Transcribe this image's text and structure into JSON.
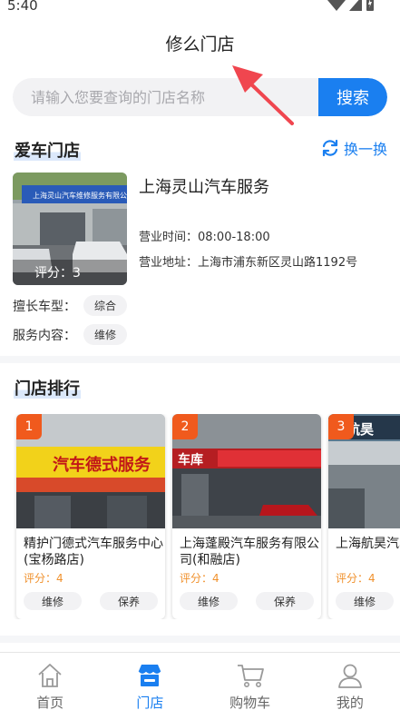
{
  "status_bar": {
    "time": "5:40"
  },
  "header": {
    "title": "修么门店"
  },
  "search": {
    "placeholder": "请输入您要查询的门店名称",
    "button_label": "搜索"
  },
  "favorite": {
    "section_title": "爱车门店",
    "swap_label": "换一换",
    "store": {
      "name": "上海灵山汽车服务",
      "rating": "评分：3",
      "hours": "营业时间：08:00-18:00",
      "address": "营业地址：上海市浦东新区灵山路1192号"
    },
    "photo_sign_text": "上海灵山汽车维修服务有限公司",
    "specialty_label": "擅长车型：",
    "specialty_value": "综合",
    "service_label": "服务内容：",
    "service_value": "维修"
  },
  "ranking": {
    "section_title": "门店排行",
    "cards": [
      {
        "rank": "1",
        "name": "精护门德式汽车服务中心(宝杨路店)",
        "rating": "评分：4",
        "tags": [
          "维修",
          "保养"
        ],
        "sign": "汽车德式服务"
      },
      {
        "rank": "2",
        "name": "上海蓬殿汽车服务有限公司(和融店)",
        "rating": "评分：4",
        "tags": [
          "维修",
          "保养"
        ],
        "sign": "车库"
      },
      {
        "rank": "3",
        "name": "上海航昊汽车服务中心",
        "rating": "评分：4",
        "tags": [
          "维修"
        ],
        "sign": "航昊"
      }
    ]
  },
  "tabbar": {
    "items": [
      {
        "label": "首页",
        "icon": "home-icon"
      },
      {
        "label": "门店",
        "icon": "store-icon",
        "active": true
      },
      {
        "label": "购物车",
        "icon": "cart-icon"
      },
      {
        "label": "我的",
        "icon": "user-icon"
      }
    ]
  },
  "colors": {
    "accent": "#1a7ff0",
    "rank_badge": "#f05a1d",
    "rating": "#f0912d",
    "annotation_arrow": "#f0464f"
  }
}
